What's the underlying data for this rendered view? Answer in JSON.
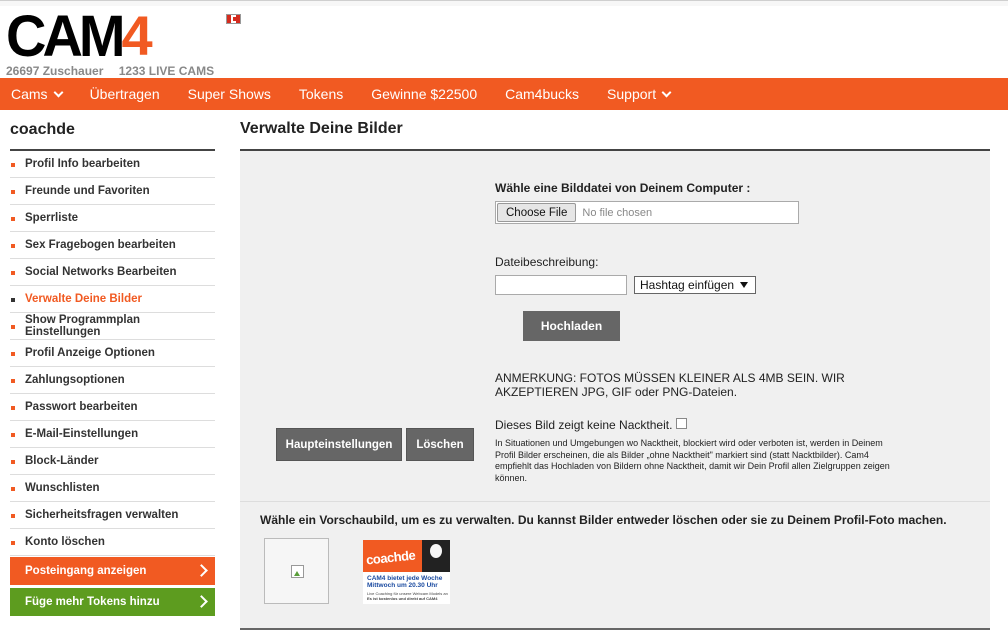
{
  "logo": {
    "part1": "CAM",
    "part2": "4"
  },
  "stats": {
    "viewers": "26697 Zuschauer",
    "live_cams": "1233 LIVE CAMS"
  },
  "nav": [
    {
      "label": "Cams",
      "dropdown": true
    },
    {
      "label": "Übertragen"
    },
    {
      "label": "Super Shows"
    },
    {
      "label": "Tokens"
    },
    {
      "label": "Gewinne $22500"
    },
    {
      "label": "Cam4bucks"
    },
    {
      "label": "Support",
      "dropdown": true
    }
  ],
  "sidebar": {
    "username": "coachde",
    "items": [
      {
        "label": "Profil Info bearbeiten"
      },
      {
        "label": "Freunde und Favoriten"
      },
      {
        "label": "Sperrliste"
      },
      {
        "label": "Sex Fragebogen bearbeiten"
      },
      {
        "label": "Social Networks Bearbeiten"
      },
      {
        "label": "Verwalte Deine Bilder",
        "active": true
      },
      {
        "label": "Show Programmplan Einstellungen"
      },
      {
        "label": "Profil Anzeige Optionen"
      },
      {
        "label": "Zahlungsoptionen"
      },
      {
        "label": "Passwort bearbeiten"
      },
      {
        "label": "E-Mail-Einstellungen"
      },
      {
        "label": "Block-Länder"
      },
      {
        "label": "Wunschlisten"
      },
      {
        "label": "Sicherheitsfragen verwalten"
      },
      {
        "label": "Konto löschen"
      }
    ],
    "inbox_button": "Posteingang anzeigen",
    "tokens_button": "Füge mehr Tokens hinzu"
  },
  "main": {
    "title": "Verwalte Deine Bilder",
    "upload": {
      "label": "Wähle eine Bilddatei von Deinem Computer :",
      "choose_file": "Choose File",
      "file_status": "No file chosen",
      "description_label": "Dateibeschreibung:",
      "description_value": "",
      "hashtag_select": "Hashtag einfügen",
      "upload_button": "Hochladen",
      "note": "ANMERKUNG: FOTOS MÜSSEN KLEINER ALS 4MB SEIN. WIR AKZEPTIEREN JPG, GIF oder PNG-Dateien.",
      "nudity_label": "Dieses Bild zeigt keine Nacktheit.",
      "nudity_checked": false,
      "nudity_info": "In Situationen und Umgebungen wo Nacktheit, blockiert wird oder verboten ist, werden in Deinem Profil Bilder erscheinen, die als Bilder „ohne Nacktheit\" markiert sind (statt Nacktbilder). Cam4 empfiehlt das Hochladen von Bildern ohne Nacktheit, damit wir Dein Profil allen Zielgruppen zeigen können."
    },
    "actions": {
      "main_settings": "Haupteinstellungen",
      "delete": "Löschen"
    },
    "thumbs": {
      "instruction": "Wähle ein Vorschaubild, um es zu verwalten. Du kannst Bilder entweder löschen oder sie zu Deinem Profil-Foto machen.",
      "promo": {
        "name": "coachde",
        "line1": "CAM4 bietet jede Woche",
        "line2": "Mittwoch um 20.30 Uhr",
        "line3": "Live Coaching für unsere Webcam Models an",
        "line4": "Es ist kostenlos und direkt auf CAM4"
      }
    }
  },
  "colors": {
    "brand": "#f15a22",
    "green": "#5d9c1f",
    "button_dark": "#666666",
    "panel": "#f0f0f0"
  }
}
